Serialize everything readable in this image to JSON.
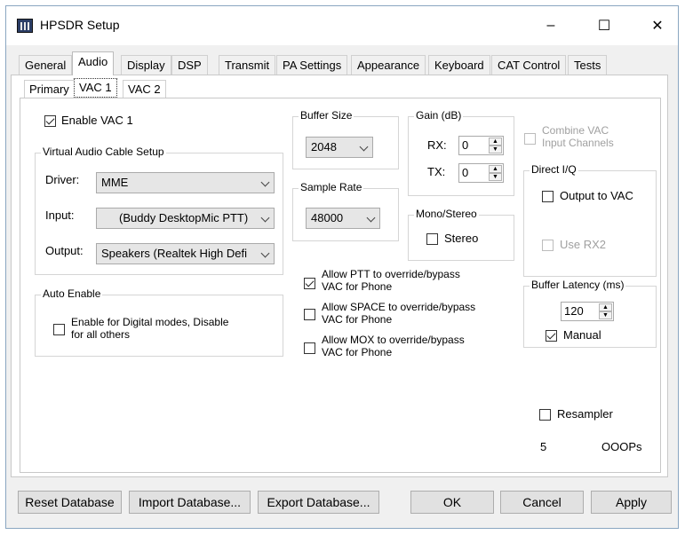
{
  "window": {
    "title": "HPSDR Setup",
    "minimize": "–",
    "maximize": "☐",
    "close": "✕"
  },
  "tabs": [
    "General",
    "Audio",
    "Display",
    "DSP",
    "Transmit",
    "PA Settings",
    "Appearance",
    "Keyboard",
    "CAT Control",
    "Tests"
  ],
  "subtabs": [
    "Primary",
    "VAC 1",
    "VAC 2"
  ],
  "enable_vac": "Enable VAC 1",
  "vac_setup": {
    "title": "Virtual Audio Cable Setup",
    "driver_label": "Driver:",
    "driver_value": "MME",
    "input_label": "Input:",
    "input_value": "(Buddy DesktopMic PTT)",
    "output_label": "Output:",
    "output_value": "Speakers (Realtek High Defi"
  },
  "auto_enable": {
    "title": "Auto Enable",
    "line1": "Enable for Digital modes, Disable",
    "line2": "for all others"
  },
  "buffer_size": {
    "title": "Buffer Size",
    "value": "2048"
  },
  "sample_rate": {
    "title": "Sample Rate",
    "value": "48000"
  },
  "gain": {
    "title": "Gain (dB)",
    "rx_label": "RX:",
    "rx_value": "0",
    "tx_label": "TX:",
    "tx_value": "0"
  },
  "mono_stereo": {
    "title": "Mono/Stereo",
    "stereo": "Stereo"
  },
  "combine": {
    "line1": "Combine VAC",
    "line2": "Input Channels"
  },
  "direct_iq": {
    "title": "Direct I/Q",
    "output": "Output to VAC",
    "use_rx2": "Use RX2"
  },
  "ptt": {
    "line1": "Allow PTT to override/bypass",
    "line2": "VAC for Phone"
  },
  "space": {
    "line1": "Allow SPACE to override/bypass",
    "line2": "VAC for Phone"
  },
  "mox": {
    "line1": "Allow MOX to override/bypass",
    "line2": "VAC for Phone"
  },
  "latency": {
    "title": "Buffer Latency (ms)",
    "value": "120",
    "manual": "Manual"
  },
  "resampler": "Resampler",
  "ooops_count": "5",
  "ooops_label": "OOOPs",
  "buttons": {
    "reset": "Reset Database",
    "import": "Import Database...",
    "export": "Export Database...",
    "ok": "OK",
    "cancel": "Cancel",
    "apply": "Apply"
  }
}
